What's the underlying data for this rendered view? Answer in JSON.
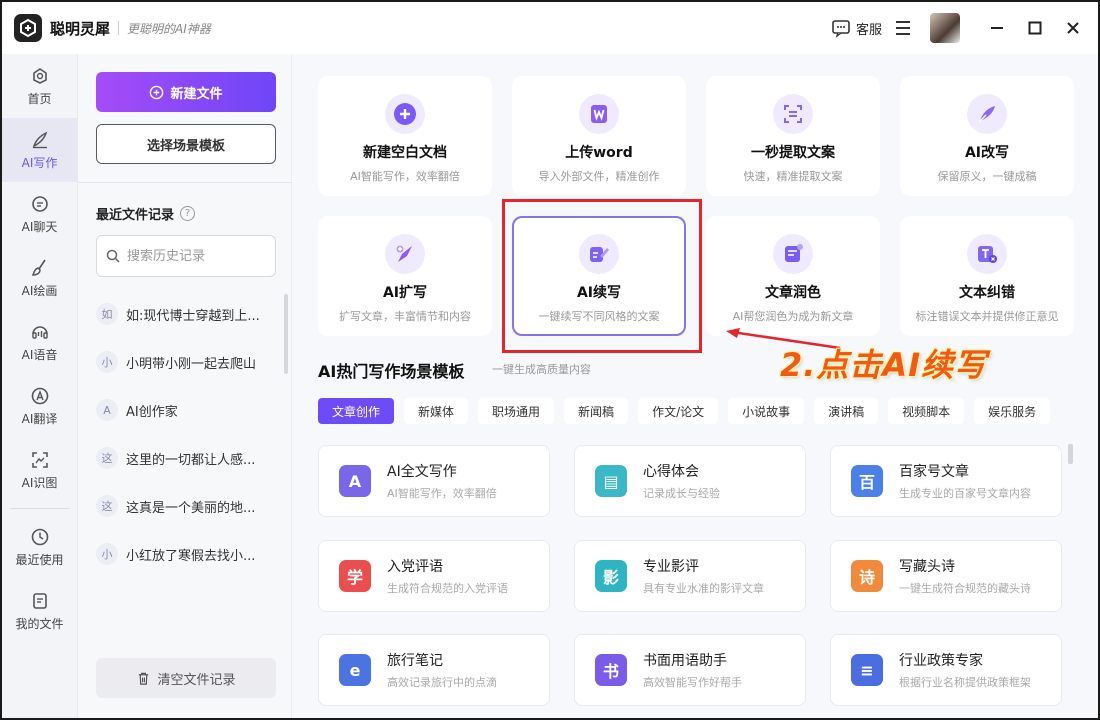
{
  "app": {
    "name": "聪明灵犀",
    "slogan": "更聪明的AI神器",
    "service_label": "客服"
  },
  "nav": {
    "items": [
      {
        "label": "首页",
        "icon": "home-icon"
      },
      {
        "label": "AI写作",
        "icon": "pen-icon"
      },
      {
        "label": "AI聊天",
        "icon": "chat-icon"
      },
      {
        "label": "AI绘画",
        "icon": "brush-icon"
      },
      {
        "label": "AI语音",
        "icon": "voice-icon"
      },
      {
        "label": "AI翻译",
        "icon": "translate-icon"
      },
      {
        "label": "AI识图",
        "icon": "scan-icon"
      },
      {
        "label": "最近使用",
        "icon": "clock-icon"
      },
      {
        "label": "我的文件",
        "icon": "file-icon"
      }
    ],
    "active": "AI写作"
  },
  "panel": {
    "new_file": "新建文件",
    "template_btn": "选择场景模板",
    "recent_title": "最近文件记录",
    "help_icon": "?",
    "search_placeholder": "搜索历史记录",
    "files": [
      {
        "badge": "如",
        "name": "如:现代博士穿越到上..."
      },
      {
        "badge": "小",
        "name": "小明带小刚一起去爬山"
      },
      {
        "badge": "A",
        "name": "AI创作家"
      },
      {
        "badge": "这",
        "name": "这里的一切都让人感..."
      },
      {
        "badge": "这",
        "name": "这真是一个美丽的地..."
      },
      {
        "badge": "小",
        "name": "小红放了寒假去找小..."
      }
    ],
    "clear": "清空文件记录"
  },
  "cards": [
    {
      "title": "新建空白文档",
      "sub": "AI智能写作，效率翻倍",
      "icon": "plus-icon",
      "color": "#7a5cf5"
    },
    {
      "title": "上传word",
      "sub": "导入外部文件，精准创作",
      "icon": "word-icon",
      "color": "#8a5cf0"
    },
    {
      "title": "一秒提取文案",
      "sub": "快速，精准提取文案",
      "icon": "extract-icon",
      "color": "#7d6af0"
    },
    {
      "title": "AI改写",
      "sub": "保留原义，一键成稿",
      "icon": "quill-icon",
      "color": "#8d6af3"
    },
    {
      "title": "AI扩写",
      "sub": "扩写文章，丰富情节和内容",
      "icon": "expand-icon",
      "color": "#8b5cf6"
    },
    {
      "title": "AI续写",
      "sub": "一键续写不同风格的文案",
      "icon": "continue-icon",
      "color": "#7b64f0"
    },
    {
      "title": "文章润色",
      "sub": "AI帮您润色为成为新文章",
      "icon": "polish-icon",
      "color": "#7a5cf5"
    },
    {
      "title": "文本纠错",
      "sub": "标注错误文本并提供修正意见",
      "icon": "correct-icon",
      "color": "#7e68ef"
    }
  ],
  "annotation": "2.点击AI续写",
  "section": {
    "title": "AI热门写作场景模板",
    "sub": "一键生成高质量内容"
  },
  "tabs": [
    "文章创作",
    "新媒体",
    "职场通用",
    "新闻稿",
    "作文/论文",
    "小说故事",
    "演讲稿",
    "视频脚本",
    "娱乐服务"
  ],
  "active_tab": "文章创作",
  "templates": [
    {
      "title": "AI全文写作",
      "sub": "AI智能写作，效率翻倍",
      "glyph": "A",
      "color": "#7a66e8"
    },
    {
      "title": "心得体会",
      "sub": "记录成长与经验",
      "glyph": "▤",
      "color": "#3bb7c8"
    },
    {
      "title": "百家号文章",
      "sub": "生成专业的百家号文章内容",
      "glyph": "百",
      "color": "#4a80e8"
    },
    {
      "title": "入党评语",
      "sub": "生成符合规范的入党评语",
      "glyph": "学",
      "color": "#ea4f4f"
    },
    {
      "title": "专业影评",
      "sub": "具有专业水准的影评文章",
      "glyph": "影",
      "color": "#2fb4c4"
    },
    {
      "title": "写藏头诗",
      "sub": "一键生成符合规范的藏头诗",
      "glyph": "诗",
      "color": "#f08a3c"
    },
    {
      "title": "旅行笔记",
      "sub": "高效记录旅行中的点滴",
      "glyph": "e",
      "color": "#4b74e0"
    },
    {
      "title": "书面用语助手",
      "sub": "高效智能写作好帮手",
      "glyph": "书",
      "color": "#7a5ce8"
    },
    {
      "title": "行业政策专家",
      "sub": "根据行业名称提供政策框架",
      "glyph": "≡",
      "color": "#4a6ee0"
    }
  ]
}
